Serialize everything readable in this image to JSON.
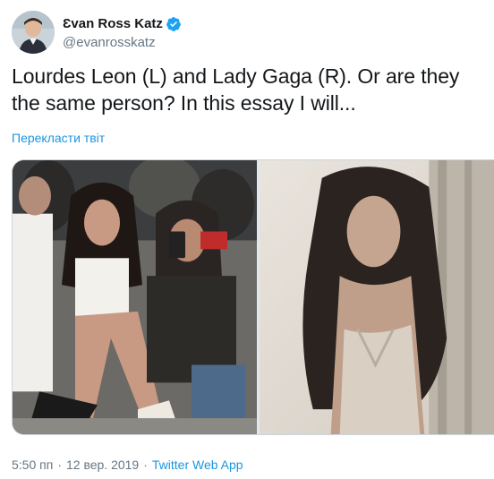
{
  "author": {
    "display_name": "Ɛvan Ross Katz",
    "handle": "@evanrosskatz",
    "verified_icon": "verified-badge-icon",
    "verified_color": "#1da1f2"
  },
  "tweet": {
    "text": "Lourdes Leon (L) and Lady Gaga (R). Or are they the same person? In this essay I will...",
    "translate_label": "Перекласти твіт"
  },
  "media": {
    "left_photo": "photo-front-row",
    "right_photo": "photo-sepia-portrait"
  },
  "meta": {
    "time": "5:50 пп",
    "separator": "·",
    "date": "12 вер. 2019",
    "app": "Twitter Web App"
  },
  "colors": {
    "link": "#1b95e0",
    "secondary_text": "#657786",
    "primary_text": "#14171a"
  }
}
